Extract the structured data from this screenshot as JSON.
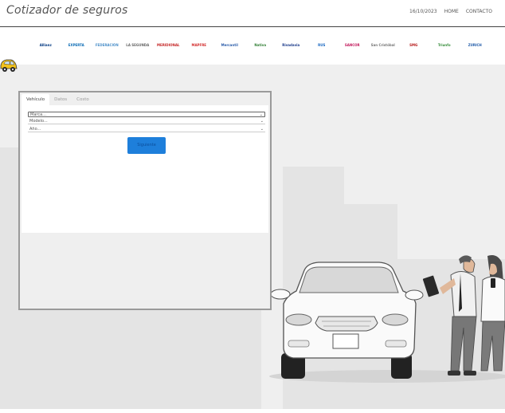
{
  "header": {
    "title": "Cotizador de seguros",
    "date": "16/10/2023",
    "nav": [
      "HOME",
      "CONTACTO"
    ]
  },
  "insurers": [
    {
      "name": "Allianz",
      "color": "#003781"
    },
    {
      "name": "EXPERTA",
      "color": "#0a6bb5"
    },
    {
      "name": "FEDERACIÓN",
      "color": "#4a8fc9"
    },
    {
      "name": "LA SEGUNDA",
      "color": "#666666"
    },
    {
      "name": "MERIDIONAL",
      "color": "#c62828"
    },
    {
      "name": "MAPFRE",
      "color": "#d32f2f"
    },
    {
      "name": "Mercantil",
      "color": "#2a5caa"
    },
    {
      "name": "Nativa",
      "color": "#2e7d32"
    },
    {
      "name": "Rivadavia",
      "color": "#1a3a8a"
    },
    {
      "name": "RUS",
      "color": "#1565c0"
    },
    {
      "name": "SANCOR",
      "color": "#c2185b"
    },
    {
      "name": "San Cristóbal",
      "color": "#757575"
    },
    {
      "name": "SMG",
      "color": "#b71c1c"
    },
    {
      "name": "Triunfo",
      "color": "#388e3c"
    },
    {
      "name": "ZURICH",
      "color": "#1e5aa8"
    }
  ],
  "form": {
    "tabs": [
      "Vehículo",
      "Datos",
      "Costo"
    ],
    "active_tab": "Vehículo",
    "selects": {
      "brand": "Marca...",
      "model": "Modelo...",
      "year": "Año..."
    },
    "submit_label": "Siguiente"
  },
  "colors": {
    "accent": "#1e7fdb",
    "background": "#efefef",
    "buildings": "#e4e4e4"
  }
}
